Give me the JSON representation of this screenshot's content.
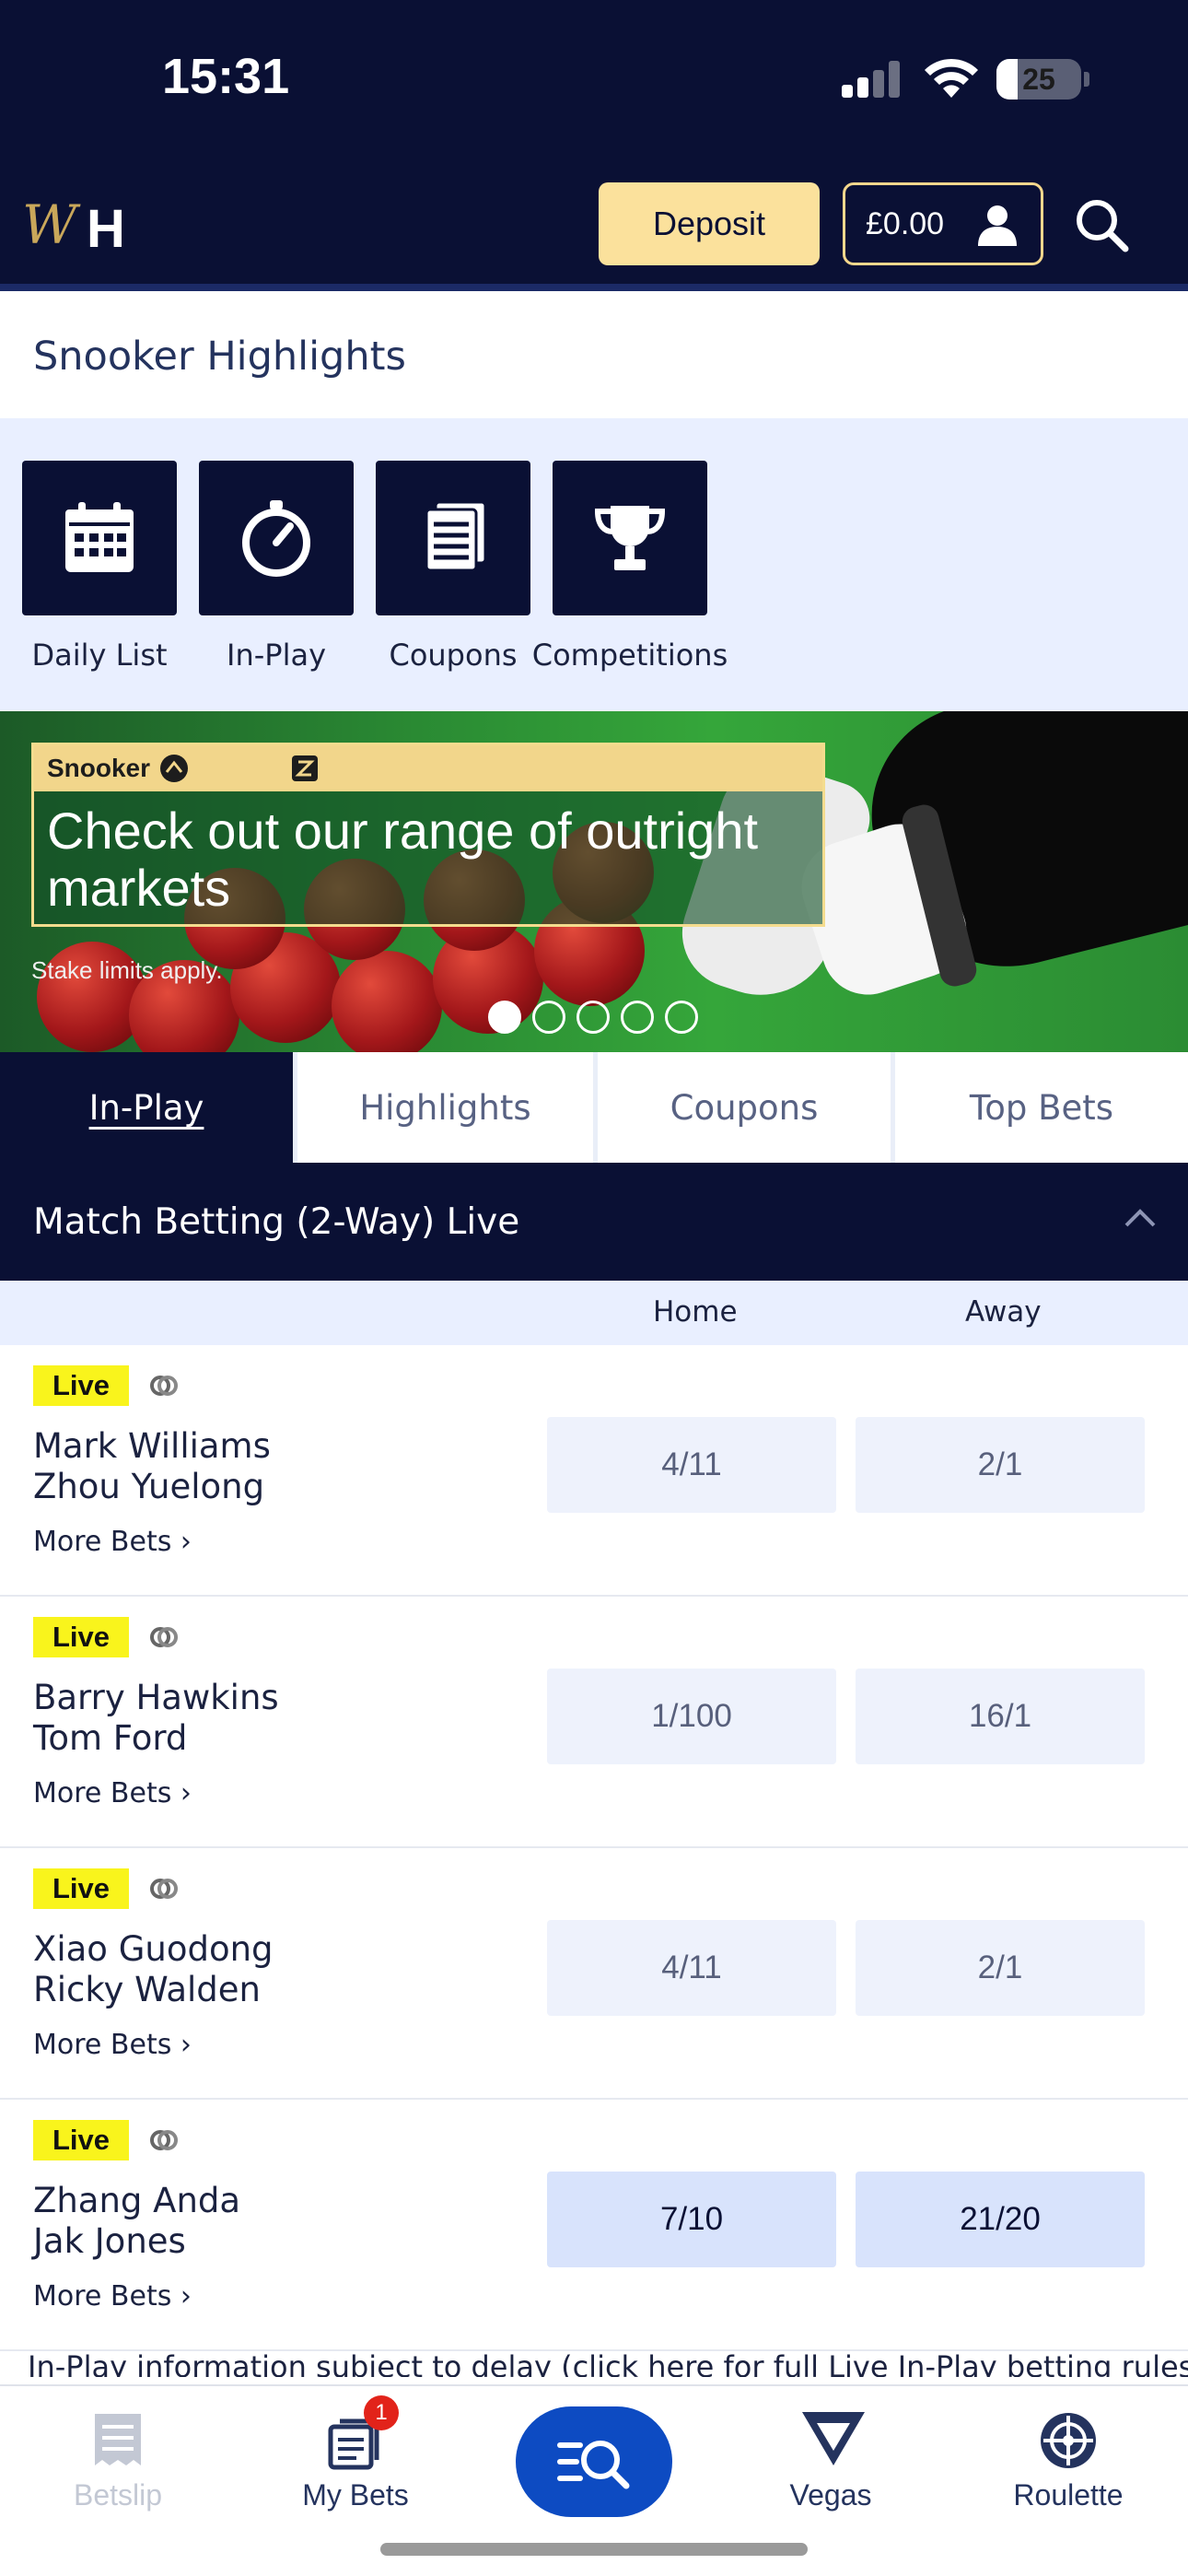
{
  "status_bar": {
    "time": "15:31",
    "battery": "25",
    "battery_level": 0.25
  },
  "header": {
    "logo_label": "WH",
    "deposit_label": "Deposit",
    "balance": "£0.00"
  },
  "page": {
    "title": "Snooker Highlights"
  },
  "quick_links": [
    {
      "label": "Daily List",
      "icon": "calendar-icon"
    },
    {
      "label": "In-Play",
      "icon": "stopwatch-icon"
    },
    {
      "label": "Coupons",
      "icon": "coupons-icon"
    },
    {
      "label": "Competitions",
      "icon": "trophy-icon"
    }
  ],
  "banner": {
    "tag": "Snooker",
    "title": "Check out our range of outright markets",
    "disclaimer": "Stake limits apply.",
    "slides": 5,
    "active_slide": 1
  },
  "tabs": [
    {
      "label": "In-Play",
      "active": true
    },
    {
      "label": "Highlights",
      "active": false
    },
    {
      "label": "Coupons",
      "active": false
    },
    {
      "label": "Top Bets",
      "active": false
    }
  ],
  "market": {
    "title": "Match Betting (2-Way) Live",
    "columns": {
      "home": "Home",
      "away": "Away"
    }
  },
  "events": [
    {
      "status": "Live",
      "player1": "Mark Williams",
      "player2": "Zhou Yuelong",
      "more": "More Bets ›",
      "home": "4/11",
      "away": "2/1",
      "highlighted": false
    },
    {
      "status": "Live",
      "player1": "Barry Hawkins",
      "player2": "Tom Ford",
      "more": "More Bets ›",
      "home": "1/100",
      "away": "16/1",
      "highlighted": false
    },
    {
      "status": "Live",
      "player1": "Xiao Guodong",
      "player2": "Ricky Walden",
      "more": "More Bets ›",
      "home": "4/11",
      "away": "2/1",
      "highlighted": false
    },
    {
      "status": "Live",
      "player1": "Zhang Anda",
      "player2": "Jak Jones",
      "more": "More Bets ›",
      "home": "7/10",
      "away": "21/20",
      "highlighted": true
    }
  ],
  "info_strip": "In-Play information subject to delay (click here for full Live In-Play betting rules)",
  "bottom_nav": {
    "items": [
      {
        "label": "Betslip",
        "icon": "betslip-icon",
        "color": "#c3c8d4"
      },
      {
        "label": "My Bets",
        "icon": "my-bets-icon",
        "badge": "1",
        "color": "#24335e"
      },
      {
        "label": "",
        "icon": "search-list-icon",
        "color": "#0d4bc2"
      },
      {
        "label": "Vegas",
        "icon": "vegas-icon",
        "color": "#24335e"
      },
      {
        "label": "Roulette",
        "icon": "roulette-icon",
        "color": "#24335e"
      }
    ]
  },
  "colors": {
    "navy": "#0a1034",
    "gold": "#fbe19c",
    "live_yellow": "#f9f41c",
    "accent_blue": "#0d4bc2"
  }
}
